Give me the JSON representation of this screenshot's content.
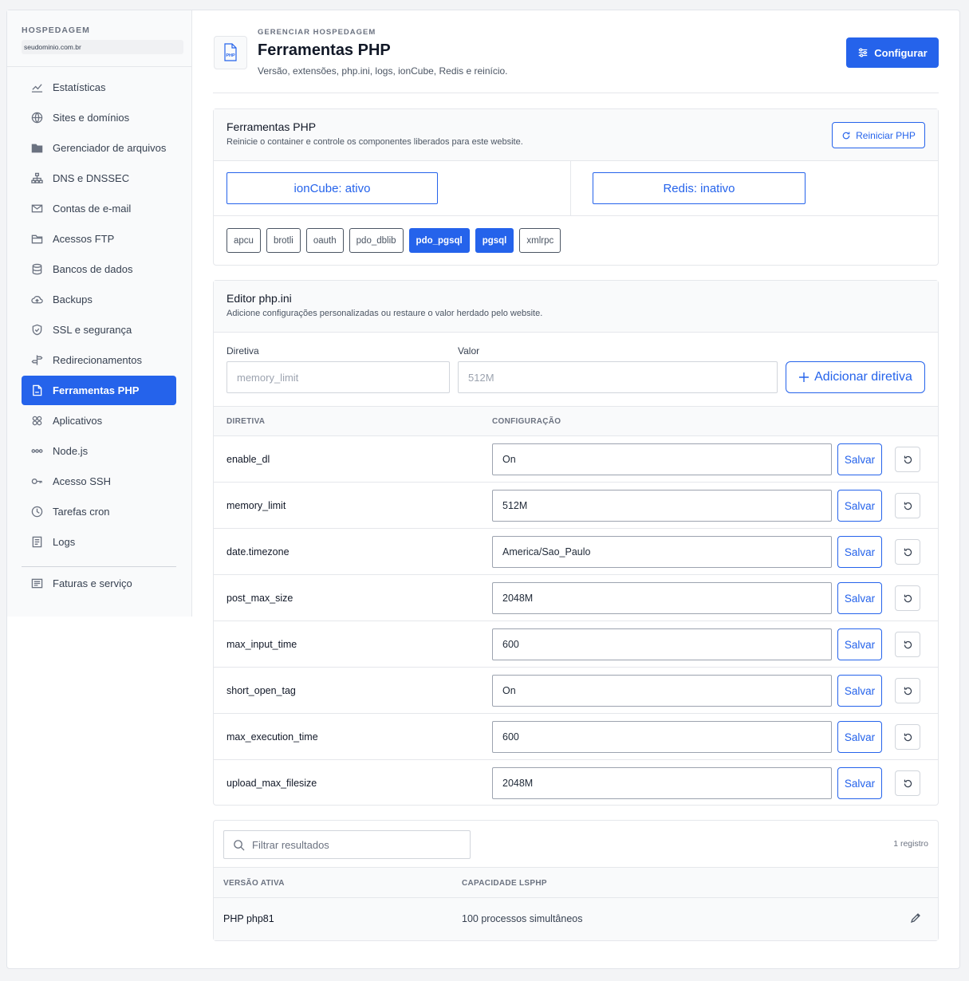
{
  "sidebar": {
    "title": "HOSPEDAGEM",
    "domain": "seudominio.com.br",
    "items": [
      {
        "label": "Estatísticas",
        "icon": "chart-line-icon"
      },
      {
        "label": "Sites e domínios",
        "icon": "globe-icon"
      },
      {
        "label": "Gerenciador de arquivos",
        "icon": "folder-icon"
      },
      {
        "label": "DNS e DNSSEC",
        "icon": "network-icon"
      },
      {
        "label": "Contas de e-mail",
        "icon": "envelope-icon"
      },
      {
        "label": "Acessos FTP",
        "icon": "folder-open-icon"
      },
      {
        "label": "Bancos de dados",
        "icon": "database-icon"
      },
      {
        "label": "Backups",
        "icon": "cloud-upload-icon"
      },
      {
        "label": "SSL e segurança",
        "icon": "shield-icon"
      },
      {
        "label": "Redirecionamentos",
        "icon": "signpost-icon"
      },
      {
        "label": "Ferramentas PHP",
        "icon": "php-file-icon"
      },
      {
        "label": "Aplicativos",
        "icon": "apps-icon"
      },
      {
        "label": "Node.js",
        "icon": "nodes-icon"
      },
      {
        "label": "Acesso SSH",
        "icon": "key-icon"
      },
      {
        "label": "Tarefas cron",
        "icon": "clock-icon"
      },
      {
        "label": "Logs",
        "icon": "log-file-icon"
      }
    ],
    "footer_item": {
      "label": "Faturas e serviço",
      "icon": "invoice-icon"
    }
  },
  "header": {
    "eyebrow": "GERENCIAR HOSPEDAGEM",
    "title": "Ferramentas PHP",
    "subtitle": "Versão, extensões, php.ini, logs, ionCube, Redis e reinício.",
    "icon_text": "PHP",
    "configure_label": "Configurar"
  },
  "tools": {
    "title": "Ferramentas PHP",
    "subtitle": "Reinicie o container e controle os componentes liberados para este website.",
    "restart_label": "Reiniciar PHP",
    "ioncube_label": "ionCube: ativo",
    "redis_label": "Redis: inativo",
    "extensions": [
      {
        "name": "apcu",
        "enabled": false
      },
      {
        "name": "brotli",
        "enabled": false
      },
      {
        "name": "oauth",
        "enabled": false
      },
      {
        "name": "pdo_dblib",
        "enabled": false
      },
      {
        "name": "pdo_pgsql",
        "enabled": true
      },
      {
        "name": "pgsql",
        "enabled": true
      },
      {
        "name": "xmlrpc",
        "enabled": false
      }
    ]
  },
  "editor": {
    "title": "Editor php.ini",
    "subtitle": "Adicione configurações personalizadas ou restaure o valor herdado pelo website.",
    "directive_label": "Diretiva",
    "value_label": "Valor",
    "directive_placeholder": "memory_limit",
    "value_placeholder": "512M",
    "add_label": "Adicionar diretiva",
    "col_directive": "DIRETIVA",
    "col_config": "CONFIGURAÇÃO",
    "save_label": "Salvar",
    "rows": [
      {
        "name": "enable_dl",
        "value": "On"
      },
      {
        "name": "memory_limit",
        "value": "512M"
      },
      {
        "name": "date.timezone",
        "value": "America/Sao_Paulo"
      },
      {
        "name": "post_max_size",
        "value": "2048M"
      },
      {
        "name": "max_input_time",
        "value": "600"
      },
      {
        "name": "short_open_tag",
        "value": "On"
      },
      {
        "name": "max_execution_time",
        "value": "600"
      },
      {
        "name": "upload_max_filesize",
        "value": "2048M"
      }
    ]
  },
  "versions": {
    "filter_placeholder": "Filtrar resultados",
    "count": "1 registro",
    "col_version": "VERSÃO ATIVA",
    "col_capacity": "CAPACIDADE LSPHP",
    "rows": [
      {
        "version": "PHP php81",
        "capacity": "100 processos simultâneos"
      }
    ]
  }
}
